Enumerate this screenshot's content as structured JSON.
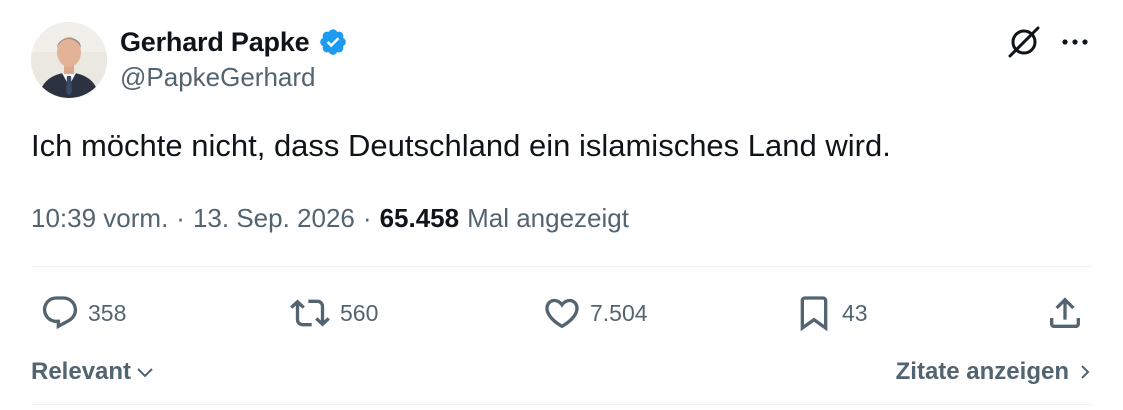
{
  "author": {
    "display_name": "Gerhard Papke",
    "handle": "@PapkeGerhard",
    "verified": true,
    "verified_color": "#1d9bf0"
  },
  "tweet": {
    "text": "Ich möchte nicht, dass Deutschland ein islamisches Land wird.",
    "time": "10:39 vorm.",
    "separator": "·",
    "date": "13. Sep. 2026",
    "views_count": "65.458",
    "views_label": "Mal angezeigt"
  },
  "actions": {
    "reply_count": "358",
    "retweet_count": "560",
    "like_count": "7.504",
    "bookmark_count": "43"
  },
  "footer": {
    "sort_label": "Relevant",
    "quotes_label": "Zitate anzeigen"
  },
  "icons": {
    "avatar": "profile-photo",
    "verified": "verified-badge-icon",
    "grok": "grok-icon",
    "more": "more-icon",
    "reply": "reply-icon",
    "retweet": "retweet-icon",
    "like": "heart-icon",
    "bookmark": "bookmark-icon",
    "share": "share-icon",
    "sort_chevron": "chevron-down-icon",
    "quotes_chevron": "chevron-right-icon"
  },
  "colors": {
    "text_primary": "#0f1419",
    "text_secondary": "#536471",
    "divider": "#eff3f4"
  }
}
